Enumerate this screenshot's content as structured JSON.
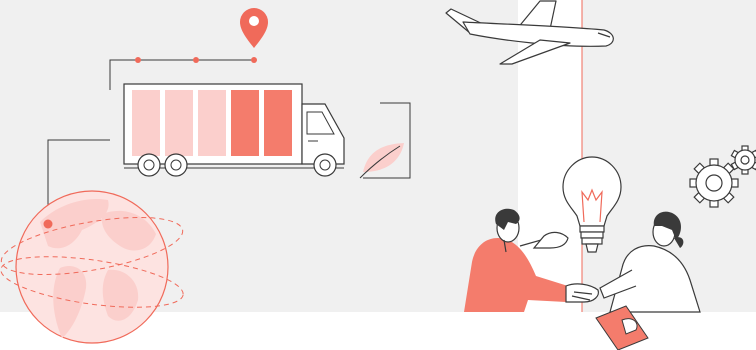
{
  "colors": {
    "background_gray": "#f0f0f0",
    "floor": "#ffffff",
    "accent_red": "#f06a5a",
    "salmon": "#f47c6c",
    "light_pink": "#fbcfcc",
    "pale_pink": "#fde3e1",
    "outline": "#3a3a3a"
  },
  "icons": [
    "location-pin-icon",
    "delivery-truck-icon",
    "leaf-icon",
    "airplane-icon",
    "globe-icon",
    "lightbulb-icon",
    "gear-icon",
    "handshake-icon",
    "document-icon"
  ],
  "truck": {
    "cargo_blocks": [
      "light",
      "light",
      "light",
      "salmon",
      "salmon"
    ]
  }
}
